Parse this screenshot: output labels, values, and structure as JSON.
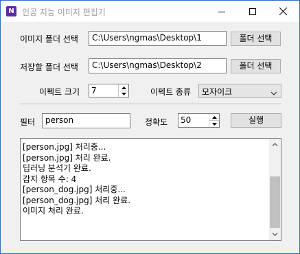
{
  "window": {
    "title": "인공 지능 이미지 편집기",
    "app_icon_letter": "N"
  },
  "source_folder": {
    "label": "이미지 폴더 선택",
    "value": "C:\\Users\\ngmas\\Desktop\\1",
    "button": "폴더 선택"
  },
  "save_folder": {
    "label": "저장할 폴더 선택",
    "value": "C:\\Users\\ngmas\\Desktop\\2",
    "button": "폴더 선택"
  },
  "effect": {
    "size_label": "이펙트 크기",
    "size_value": "7",
    "type_label": "이펙트 종류",
    "type_value": "모자이크"
  },
  "filter": {
    "label": "필터",
    "value": "person",
    "accuracy_label": "정확도",
    "accuracy_value": "50",
    "run_button": "실행"
  },
  "log": {
    "lines": [
      "[person.jpg] 처리중...",
      "[person.jpg] 처리 완료.",
      "딥러닝 분석기 완료.",
      "감지 항목 수: 4",
      "[person_dog.jpg] 처리중...",
      "[person_dog.jpg] 처리 완료.",
      "이미지 처리 완료."
    ]
  },
  "colors": {
    "window_border": "#2b6fc4",
    "app_icon": "#5b2ca0"
  },
  "icons": {
    "minimize": "minimize-icon",
    "maximize": "maximize-icon",
    "close": "close-icon",
    "app": "app-icon"
  }
}
